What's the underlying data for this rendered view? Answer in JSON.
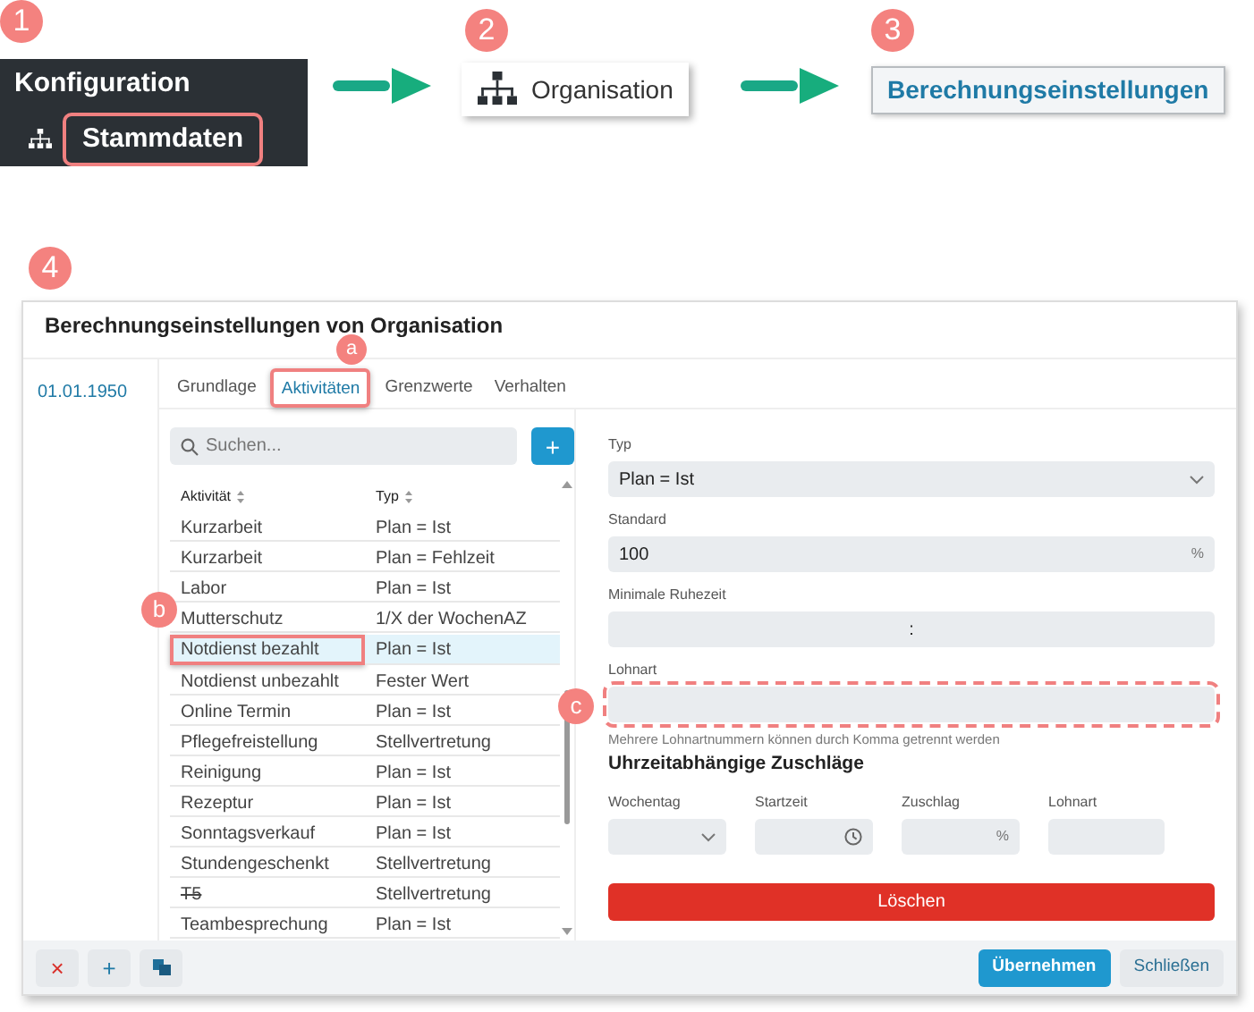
{
  "steps": [
    {
      "badge": "1",
      "kind": "menu",
      "title": "Konfiguration",
      "item": "Stammdaten"
    },
    {
      "badge": "2",
      "kind": "node",
      "label": "Organisation"
    },
    {
      "badge": "3",
      "kind": "link",
      "label": "Berechnungseinstellungen"
    }
  ],
  "dialog": {
    "badge": "4",
    "title": "Berechnungseinstellungen von Organisation",
    "versions": [
      "01.01.1950"
    ],
    "tabs": [
      {
        "label": "Grundlage",
        "selected": false
      },
      {
        "label": "Aktivitäten",
        "selected": true,
        "callout": "a"
      },
      {
        "label": "Grenzwerte",
        "selected": false
      },
      {
        "label": "Verhalten",
        "selected": false
      }
    ],
    "search": {
      "placeholder": "Suchen..."
    },
    "add_button": "+",
    "table": {
      "columns": [
        "Aktivität",
        "Typ"
      ],
      "rows": [
        {
          "cells": [
            "Kurzarbeit",
            "Plan = Ist"
          ],
          "selected": false,
          "struck": false
        },
        {
          "cells": [
            "Kurzarbeit",
            "Plan = Fehlzeit"
          ],
          "selected": false,
          "struck": false
        },
        {
          "cells": [
            "Labor",
            "Plan = Ist"
          ],
          "selected": false,
          "struck": false
        },
        {
          "cells": [
            "Mutterschutz",
            "1/X der WochenAZ"
          ],
          "selected": false,
          "struck": false
        },
        {
          "cells": [
            "Notdienst bezahlt",
            "Plan = Ist"
          ],
          "selected": true,
          "struck": false,
          "callout": "b"
        },
        {
          "cells": [
            "Notdienst unbezahlt",
            "Fester Wert"
          ],
          "selected": false,
          "struck": false
        },
        {
          "cells": [
            "Online Termin",
            "Plan = Ist"
          ],
          "selected": false,
          "struck": false
        },
        {
          "cells": [
            "Pflegefreistellung",
            "Stellvertretung"
          ],
          "selected": false,
          "struck": false
        },
        {
          "cells": [
            "Reinigung",
            "Plan = Ist"
          ],
          "selected": false,
          "struck": false
        },
        {
          "cells": [
            "Rezeptur",
            "Plan = Ist"
          ],
          "selected": false,
          "struck": false
        },
        {
          "cells": [
            "Sonntagsverkauf",
            "Plan = Ist"
          ],
          "selected": false,
          "struck": false
        },
        {
          "cells": [
            "Stundengeschenkt",
            "Stellvertretung"
          ],
          "selected": false,
          "struck": false
        },
        {
          "cells": [
            "T5",
            "Stellvertretung"
          ],
          "selected": false,
          "struck": true
        },
        {
          "cells": [
            "Teambesprechung",
            "Plan = Ist"
          ],
          "selected": false,
          "struck": false
        }
      ]
    },
    "form": {
      "fields": [
        {
          "label": "Typ",
          "kind": "select",
          "value": "Plan = Ist"
        },
        {
          "label": "Standard",
          "kind": "suffix",
          "value": "100",
          "suffix": "%"
        },
        {
          "label": "Minimale Ruhezeit",
          "kind": "time",
          "value": ":"
        },
        {
          "label": "Lohnart",
          "kind": "text",
          "hint": "Mehrere Lohnartnummern können durch Komma getrennt werden",
          "callout": "c"
        }
      ],
      "section_title": "Uhrzeitabhängige Zuschläge",
      "surcharge_fields": [
        {
          "label": "Wochentag",
          "kind": "select"
        },
        {
          "label": "Startzeit",
          "kind": "clock"
        },
        {
          "label": "Zuschlag",
          "kind": "suffix",
          "suffix": "%"
        },
        {
          "label": "Lohnart",
          "kind": "text"
        }
      ],
      "delete_button": "Löschen"
    },
    "footer": {
      "tools": [
        {
          "kind": "delete",
          "label": "×"
        },
        {
          "kind": "add",
          "label": "+"
        },
        {
          "kind": "copy"
        }
      ],
      "buttons": [
        {
          "label": "Übernehmen",
          "kind": "primary"
        },
        {
          "label": "Schließen",
          "kind": "secondary"
        }
      ]
    }
  }
}
